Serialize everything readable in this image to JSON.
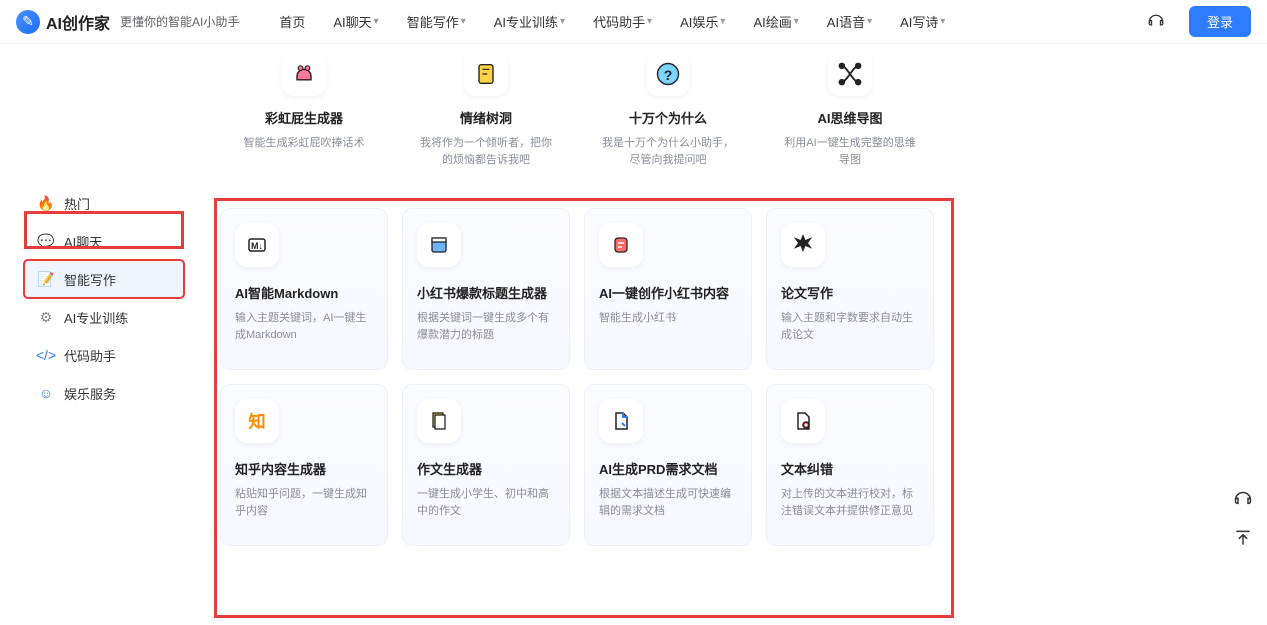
{
  "header": {
    "brand": "AI创作家",
    "slogan": "更懂你的智能AI小助手",
    "nav": [
      "首页",
      "AI聊天",
      "智能写作",
      "AI专业训练",
      "代码助手",
      "AI娱乐",
      "AI绘画",
      "AI语音",
      "AI写诗"
    ],
    "nav_dropdown": [
      false,
      true,
      true,
      true,
      true,
      true,
      true,
      true,
      true
    ],
    "login": "登录"
  },
  "sidebar": {
    "items": [
      {
        "label": "热门",
        "icon": "🔥",
        "color": "#4a90ff"
      },
      {
        "label": "AI聊天",
        "icon": "💬",
        "color": "#2d7bff"
      },
      {
        "label": "智能写作",
        "icon": "📝",
        "color": "#2d7bff",
        "active": true
      },
      {
        "label": "AI专业训练",
        "icon": "⚙",
        "color": "#888"
      },
      {
        "label": "代码助手",
        "icon": "</>",
        "color": "#2d7bff"
      },
      {
        "label": "娱乐服务",
        "icon": "☺",
        "color": "#2d7bff"
      }
    ]
  },
  "top_cards": [
    {
      "title": "彩虹屁生成器",
      "desc": "智能生成彩虹屁吹捧话术"
    },
    {
      "title": "情绪树洞",
      "desc": "我将作为一个倾听者，把你的烦恼都告诉我吧"
    },
    {
      "title": "十万个为什么",
      "desc": "我是十万个为什么小助手，尽管向我提问吧"
    },
    {
      "title": "AI思维导图",
      "desc": "利用AI一键生成完整的思维导图"
    }
  ],
  "cards": [
    {
      "title": "AI智能Markdown",
      "desc": "输入主题关键词，AI一键生成Markdown"
    },
    {
      "title": "小红书爆款标题生成器",
      "desc": "根据关键词一键生成多个有爆款潜力的标题"
    },
    {
      "title": "AI一键创作小红书内容",
      "desc": "智能生成小红书"
    },
    {
      "title": "论文写作",
      "desc": "输入主题和字数要求自动生成论文"
    },
    {
      "title": "知乎内容生成器",
      "desc": "粘贴知乎问题，一键生成知乎内容"
    },
    {
      "title": "作文生成器",
      "desc": "一键生成小学生、初中和高中的作文"
    },
    {
      "title": "AI生成PRD需求文档",
      "desc": "根据文本描述生成可快速编辑的需求文档"
    },
    {
      "title": "文本纠错",
      "desc": "对上传的文本进行校对，标注错误文本并提供修正意见"
    }
  ]
}
